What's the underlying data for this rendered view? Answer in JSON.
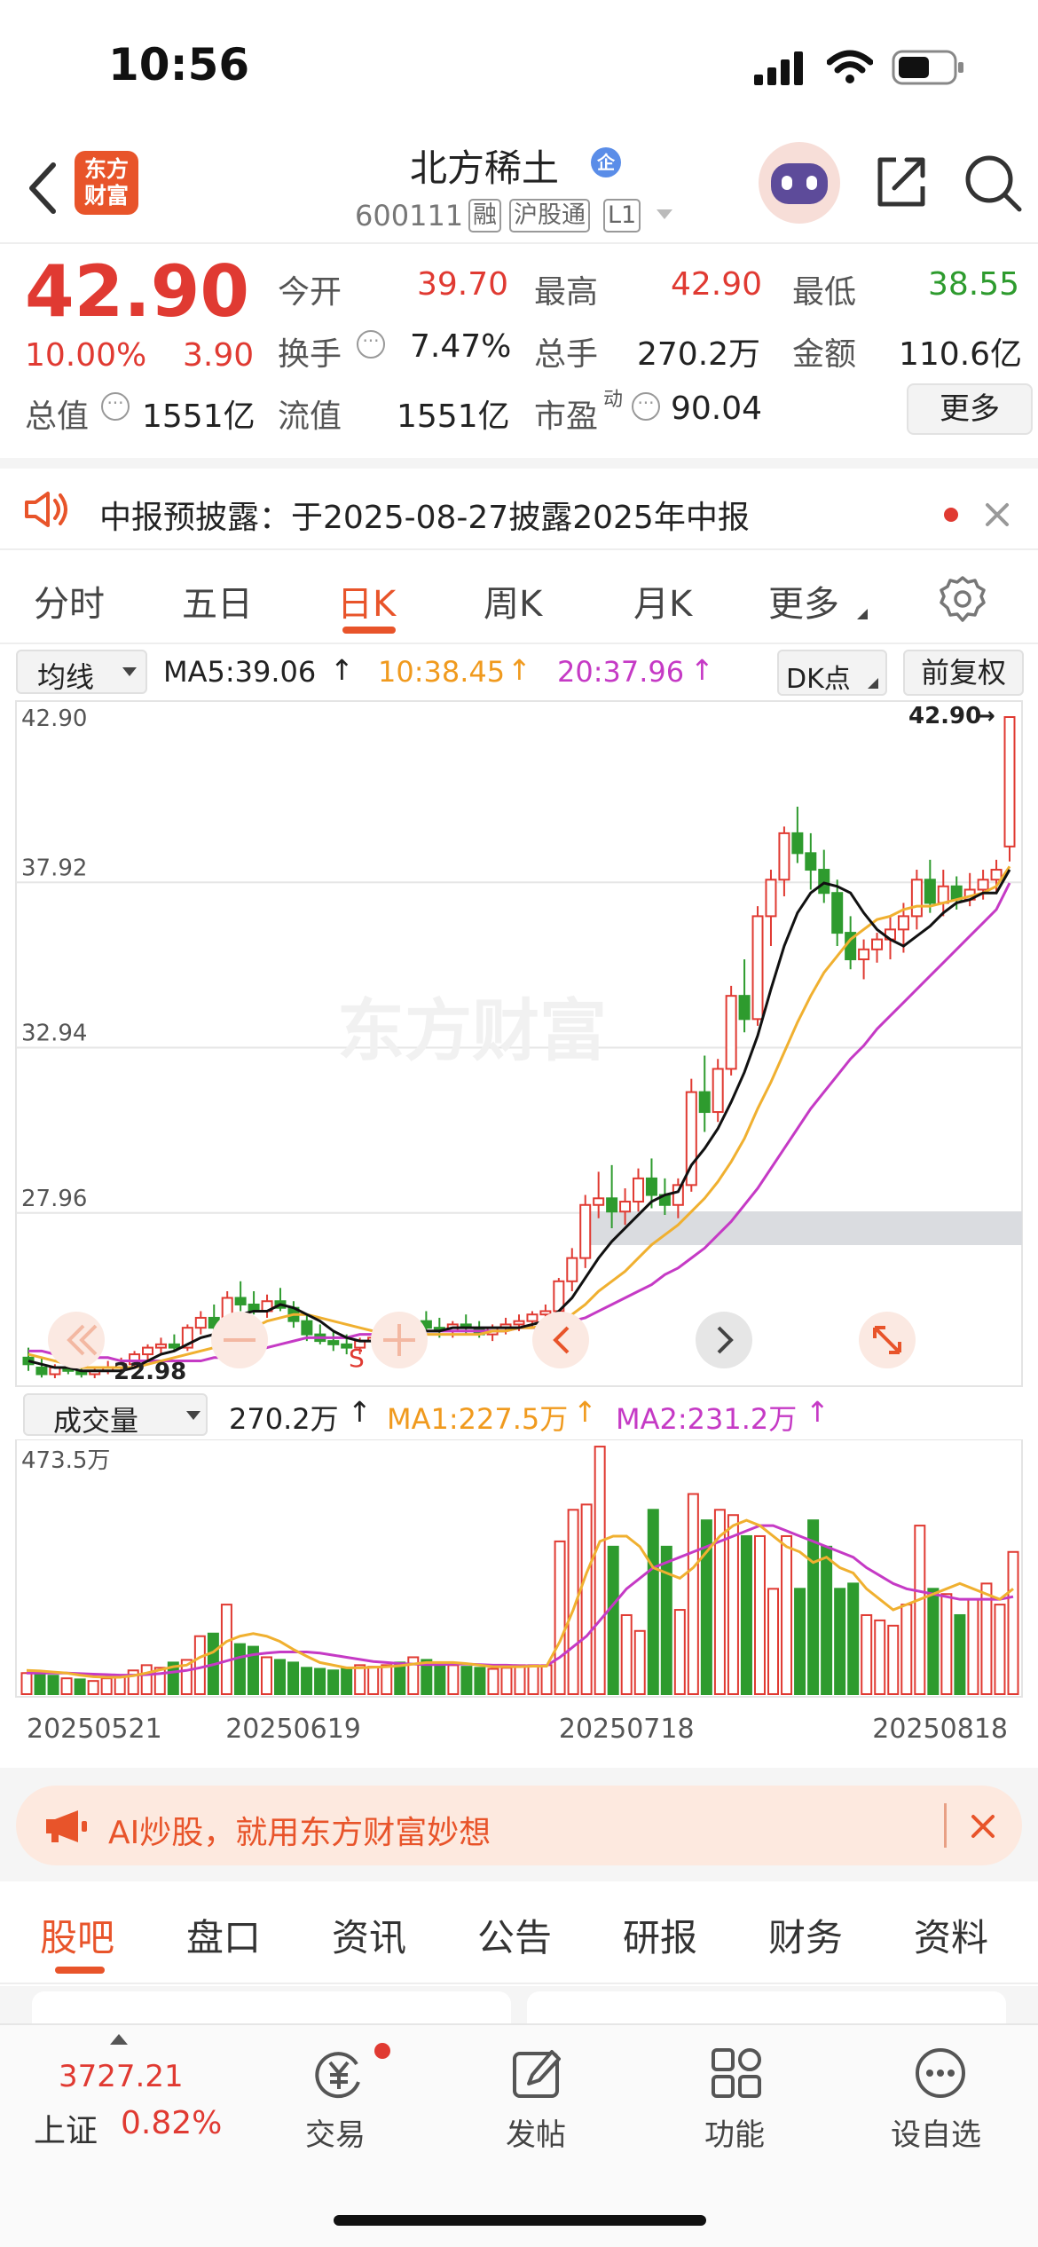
{
  "status_bar": {
    "time": "10:56"
  },
  "header": {
    "logo_text": "东方财富",
    "stock_name": "北方稀土",
    "verified_badge": "企",
    "code": "600111",
    "tags": [
      "融",
      "沪股通",
      "L1"
    ]
  },
  "quote": {
    "price": "42.90",
    "change_pct": "10.00%",
    "change_amt": "3.90",
    "fields": [
      {
        "label": "今开",
        "value": "39.70"
      },
      {
        "label": "最高",
        "value": "42.90"
      },
      {
        "label": "最低",
        "value": "38.55"
      },
      {
        "label": "换手",
        "value": "7.47%"
      },
      {
        "label": "总手",
        "value": "270.2万"
      },
      {
        "label": "金额",
        "value": "110.6亿"
      },
      {
        "label": "总值",
        "value": "1551亿"
      },
      {
        "label": "流值",
        "value": "1551亿"
      },
      {
        "label": "市盈",
        "sup": "动",
        "value": "90.04"
      }
    ],
    "more_button": "更多"
  },
  "notice": {
    "text": "中报预披露：于2025-08-27披露2025年中报"
  },
  "period_tabs": [
    "分时",
    "五日",
    "日K",
    "周K",
    "月K",
    "更多"
  ],
  "period_selected": 2,
  "indicator": {
    "dropdown": "均线",
    "ma5": "MA5:39.06",
    "ma10": "10:38.45",
    "ma20": "20:37.96",
    "dk_button": "DK点",
    "fq_button": "前复权"
  },
  "watermark": "东方财富",
  "chart_data": [
    {
      "type": "candlestick",
      "y_ticks": [
        "42.90",
        "37.92",
        "32.94",
        "27.96"
      ],
      "ylim": [
        22.98,
        42.9
      ],
      "max_label": "42.90",
      "min_label": "22.98",
      "marker": "S",
      "candles_ohlc": [
        [
          23.6,
          23.9,
          23.2,
          23.4
        ],
        [
          23.3,
          23.6,
          23.0,
          23.1
        ],
        [
          23.1,
          23.4,
          22.98,
          23.3
        ],
        [
          23.3,
          23.5,
          23.1,
          23.2
        ],
        [
          23.2,
          23.4,
          23.0,
          23.1
        ],
        [
          23.1,
          23.3,
          22.98,
          23.2
        ],
        [
          23.2,
          23.5,
          23.1,
          23.3
        ],
        [
          23.3,
          23.6,
          23.2,
          23.4
        ],
        [
          23.4,
          23.8,
          23.3,
          23.7
        ],
        [
          23.7,
          24.0,
          23.5,
          23.9
        ],
        [
          23.9,
          24.2,
          23.7,
          24.0
        ],
        [
          24.0,
          24.3,
          23.8,
          23.9
        ],
        [
          23.9,
          24.6,
          23.8,
          24.5
        ],
        [
          24.5,
          25.0,
          24.3,
          24.8
        ],
        [
          24.8,
          25.2,
          24.4,
          24.5
        ],
        [
          24.5,
          25.6,
          24.4,
          25.4
        ],
        [
          25.4,
          25.9,
          25.0,
          25.2
        ],
        [
          25.2,
          25.6,
          24.9,
          25.0
        ],
        [
          25.0,
          25.5,
          24.8,
          25.3
        ],
        [
          25.3,
          25.7,
          25.0,
          25.1
        ],
        [
          25.1,
          25.3,
          24.5,
          24.7
        ],
        [
          24.7,
          24.9,
          24.1,
          24.3
        ],
        [
          24.3,
          24.6,
          24.0,
          24.1
        ],
        [
          24.1,
          24.4,
          23.8,
          24.0
        ],
        [
          24.0,
          24.3,
          23.7,
          23.9
        ],
        [
          23.9,
          24.2,
          23.7,
          24.1
        ],
        [
          24.1,
          24.4,
          23.9,
          24.2
        ],
        [
          24.2,
          24.5,
          24.0,
          24.3
        ],
        [
          24.3,
          24.6,
          24.0,
          24.2
        ],
        [
          24.2,
          24.8,
          24.1,
          24.7
        ],
        [
          24.7,
          25.0,
          24.4,
          24.5
        ],
        [
          24.5,
          24.8,
          24.2,
          24.4
        ],
        [
          24.4,
          24.7,
          24.2,
          24.6
        ],
        [
          24.6,
          24.9,
          24.3,
          24.5
        ],
        [
          24.5,
          24.7,
          24.2,
          24.3
        ],
        [
          24.3,
          24.6,
          24.1,
          24.5
        ],
        [
          24.5,
          24.8,
          24.3,
          24.6
        ],
        [
          24.6,
          24.9,
          24.4,
          24.7
        ],
        [
          24.7,
          25.0,
          24.5,
          24.9
        ],
        [
          24.9,
          25.2,
          24.6,
          25.0
        ],
        [
          25.0,
          26.0,
          24.9,
          25.9
        ],
        [
          25.9,
          26.9,
          25.6,
          26.6
        ],
        [
          26.6,
          28.5,
          26.3,
          28.2
        ],
        [
          28.2,
          29.2,
          27.8,
          28.4
        ],
        [
          28.4,
          29.4,
          27.5,
          28.0
        ],
        [
          28.0,
          28.7,
          27.6,
          28.3
        ],
        [
          28.3,
          29.3,
          28.0,
          29.0
        ],
        [
          29.0,
          29.6,
          28.1,
          28.5
        ],
        [
          28.5,
          29.0,
          27.9,
          28.2
        ],
        [
          28.2,
          29.0,
          27.8,
          28.8
        ],
        [
          28.8,
          32.0,
          28.6,
          31.6
        ],
        [
          31.6,
          32.7,
          30.4,
          31.0
        ],
        [
          31.0,
          32.6,
          30.7,
          32.3
        ],
        [
          32.3,
          34.8,
          32.1,
          34.5
        ],
        [
          34.5,
          35.6,
          33.4,
          33.8
        ],
        [
          33.8,
          37.2,
          33.6,
          36.9
        ],
        [
          36.9,
          38.3,
          36.0,
          38.0
        ],
        [
          38.0,
          39.6,
          37.5,
          39.4
        ],
        [
          39.4,
          40.2,
          38.5,
          38.8
        ],
        [
          38.8,
          39.4,
          37.7,
          38.3
        ],
        [
          38.3,
          38.9,
          37.3,
          37.6
        ],
        [
          37.6,
          38.0,
          36.0,
          36.4
        ],
        [
          36.4,
          36.9,
          35.3,
          35.6
        ],
        [
          35.6,
          36.2,
          35.0,
          35.9
        ],
        [
          35.9,
          36.4,
          35.5,
          36.2
        ],
        [
          36.2,
          36.9,
          35.6,
          36.5
        ],
        [
          36.5,
          37.3,
          35.8,
          36.9
        ],
        [
          36.9,
          38.3,
          36.5,
          38.0
        ],
        [
          38.0,
          38.6,
          37.0,
          37.3
        ],
        [
          37.3,
          38.3,
          36.9,
          37.8
        ],
        [
          37.8,
          38.1,
          37.1,
          37.4
        ],
        [
          37.4,
          38.2,
          37.2,
          37.7
        ],
        [
          37.7,
          38.3,
          37.4,
          38.0
        ],
        [
          38.0,
          38.6,
          37.6,
          38.3
        ],
        [
          39.0,
          42.9,
          38.55,
          42.9
        ]
      ],
      "ma5_close": [
        23.5,
        23.4,
        23.3,
        23.3,
        23.2,
        23.2,
        23.2,
        23.2,
        23.3,
        23.5,
        23.7,
        23.8,
        24.0,
        24.2,
        24.3,
        24.6,
        24.9,
        25.0,
        25.0,
        25.2,
        25.1,
        24.9,
        24.7,
        24.4,
        24.2,
        24.1,
        24.1,
        24.1,
        24.2,
        24.3,
        24.4,
        24.4,
        24.5,
        24.5,
        24.5,
        24.5,
        24.5,
        24.5,
        24.6,
        24.7,
        25.0,
        25.4,
        26.0,
        26.6,
        27.1,
        27.5,
        27.9,
        28.3,
        28.5,
        28.6,
        29.4,
        29.9,
        30.5,
        31.3,
        32.2,
        33.3,
        34.7,
        36.0,
        37.0,
        37.6,
        37.9,
        37.8,
        37.6,
        37.0,
        36.5,
        36.2,
        36.0,
        36.3,
        36.6,
        37.0,
        37.3,
        37.4,
        37.6,
        37.6,
        38.3
      ],
      "ma10_close": [
        23.7,
        23.6,
        23.5,
        23.4,
        23.3,
        23.3,
        23.3,
        23.3,
        23.3,
        23.4,
        23.5,
        23.6,
        23.7,
        23.8,
        23.9,
        24.1,
        24.3,
        24.5,
        24.7,
        24.8,
        24.9,
        24.9,
        24.8,
        24.7,
        24.6,
        24.5,
        24.4,
        24.3,
        24.3,
        24.3,
        24.3,
        24.3,
        24.3,
        24.3,
        24.3,
        24.4,
        24.4,
        24.5,
        24.5,
        24.6,
        24.7,
        24.9,
        25.2,
        25.6,
        25.9,
        26.2,
        26.6,
        27.0,
        27.3,
        27.6,
        28.0,
        28.4,
        28.9,
        29.5,
        30.2,
        31.1,
        31.9,
        32.8,
        33.7,
        34.5,
        35.2,
        35.7,
        36.2,
        36.5,
        36.8,
        36.9,
        37.1,
        37.2,
        37.2,
        37.3,
        37.4,
        37.5,
        37.6,
        37.8,
        38.4
      ],
      "ma20_close": [
        23.8,
        23.8,
        23.7,
        23.7,
        23.6,
        23.6,
        23.6,
        23.5,
        23.5,
        23.5,
        23.5,
        23.5,
        23.5,
        23.5,
        23.6,
        23.6,
        23.7,
        23.8,
        23.9,
        24.0,
        24.1,
        24.2,
        24.2,
        24.2,
        24.2,
        24.3,
        24.3,
        24.3,
        24.4,
        24.4,
        24.4,
        24.4,
        24.4,
        24.4,
        24.4,
        24.4,
        24.4,
        24.5,
        24.5,
        24.5,
        24.6,
        24.7,
        24.8,
        25.0,
        25.2,
        25.4,
        25.6,
        25.8,
        26.1,
        26.3,
        26.6,
        26.9,
        27.3,
        27.7,
        28.2,
        28.7,
        29.3,
        29.9,
        30.5,
        31.1,
        31.6,
        32.1,
        32.6,
        33.0,
        33.5,
        33.9,
        34.3,
        34.7,
        35.1,
        35.5,
        35.9,
        36.3,
        36.7,
        37.1,
        37.9
      ]
    },
    {
      "type": "bar",
      "title": "成交量",
      "value_label": "270.2万",
      "ma1_label": "MA1:227.5万",
      "ma2_label": "MA2:231.2万",
      "y_max_label": "473.5万",
      "ylim": [
        0,
        473.5
      ],
      "date_labels": [
        "20250521",
        "20250619",
        "20250718",
        "20250818"
      ],
      "volumes": [
        40,
        38,
        35,
        30,
        28,
        25,
        30,
        32,
        45,
        55,
        50,
        60,
        65,
        110,
        115,
        170,
        95,
        90,
        70,
        65,
        60,
        50,
        48,
        45,
        50,
        55,
        52,
        55,
        60,
        70,
        65,
        60,
        55,
        52,
        50,
        48,
        50,
        55,
        55,
        55,
        290,
        350,
        360,
        470,
        280,
        150,
        120,
        350,
        280,
        160,
        380,
        330,
        350,
        340,
        300,
        300,
        200,
        300,
        200,
        330,
        280,
        200,
        210,
        150,
        140,
        130,
        170,
        320,
        200,
        190,
        150,
        180,
        210,
        170,
        270
      ],
      "up": [
        1,
        0,
        0,
        1,
        0,
        1,
        1,
        1,
        1,
        1,
        1,
        0,
        1,
        1,
        0,
        1,
        0,
        0,
        1,
        0,
        0,
        0,
        0,
        0,
        0,
        1,
        1,
        1,
        0,
        1,
        0,
        0,
        1,
        0,
        0,
        1,
        1,
        1,
        1,
        1,
        1,
        1,
        1,
        1,
        0,
        1,
        1,
        0,
        0,
        1,
        1,
        0,
        1,
        1,
        0,
        1,
        1,
        1,
        0,
        0,
        0,
        0,
        0,
        1,
        1,
        1,
        1,
        1,
        0,
        1,
        0,
        1,
        1,
        1,
        1
      ],
      "ma1": [
        45,
        44,
        42,
        40,
        36,
        33,
        32,
        32,
        35,
        40,
        46,
        52,
        55,
        70,
        80,
        100,
        110,
        115,
        110,
        100,
        85,
        72,
        60,
        55,
        50,
        50,
        51,
        52,
        54,
        57,
        60,
        60,
        60,
        58,
        55,
        52,
        52,
        52,
        53,
        53,
        100,
        160,
        230,
        290,
        300,
        300,
        280,
        240,
        230,
        220,
        240,
        270,
        300,
        320,
        330,
        320,
        300,
        280,
        270,
        250,
        260,
        240,
        230,
        200,
        180,
        160,
        170,
        180,
        190,
        200,
        210,
        200,
        190,
        180,
        200
      ],
      "ma2": [
        40,
        40,
        40,
        40,
        39,
        38,
        37,
        36,
        36,
        37,
        39,
        42,
        45,
        50,
        56,
        63,
        70,
        75,
        78,
        80,
        80,
        80,
        78,
        74,
        70,
        66,
        62,
        60,
        58,
        57,
        56,
        56,
        57,
        57,
        56,
        55,
        55,
        54,
        54,
        54,
        70,
        90,
        110,
        140,
        170,
        200,
        220,
        240,
        250,
        260,
        270,
        280,
        290,
        300,
        310,
        320,
        320,
        310,
        300,
        290,
        280,
        270,
        260,
        240,
        225,
        210,
        200,
        195,
        190,
        185,
        180,
        180,
        180,
        180,
        185
      ]
    }
  ],
  "ad": {
    "text": "AI炒股，就用东方财富妙想"
  },
  "content_tabs": [
    "股吧",
    "盘口",
    "资讯",
    "公告",
    "研报",
    "财务",
    "资料"
  ],
  "content_selected": 0,
  "bottom_nav": {
    "index_value": "3727.21",
    "index_name": "上证",
    "index_change": "0.82%",
    "items": [
      "交易",
      "发帖",
      "功能",
      "设自选"
    ]
  }
}
